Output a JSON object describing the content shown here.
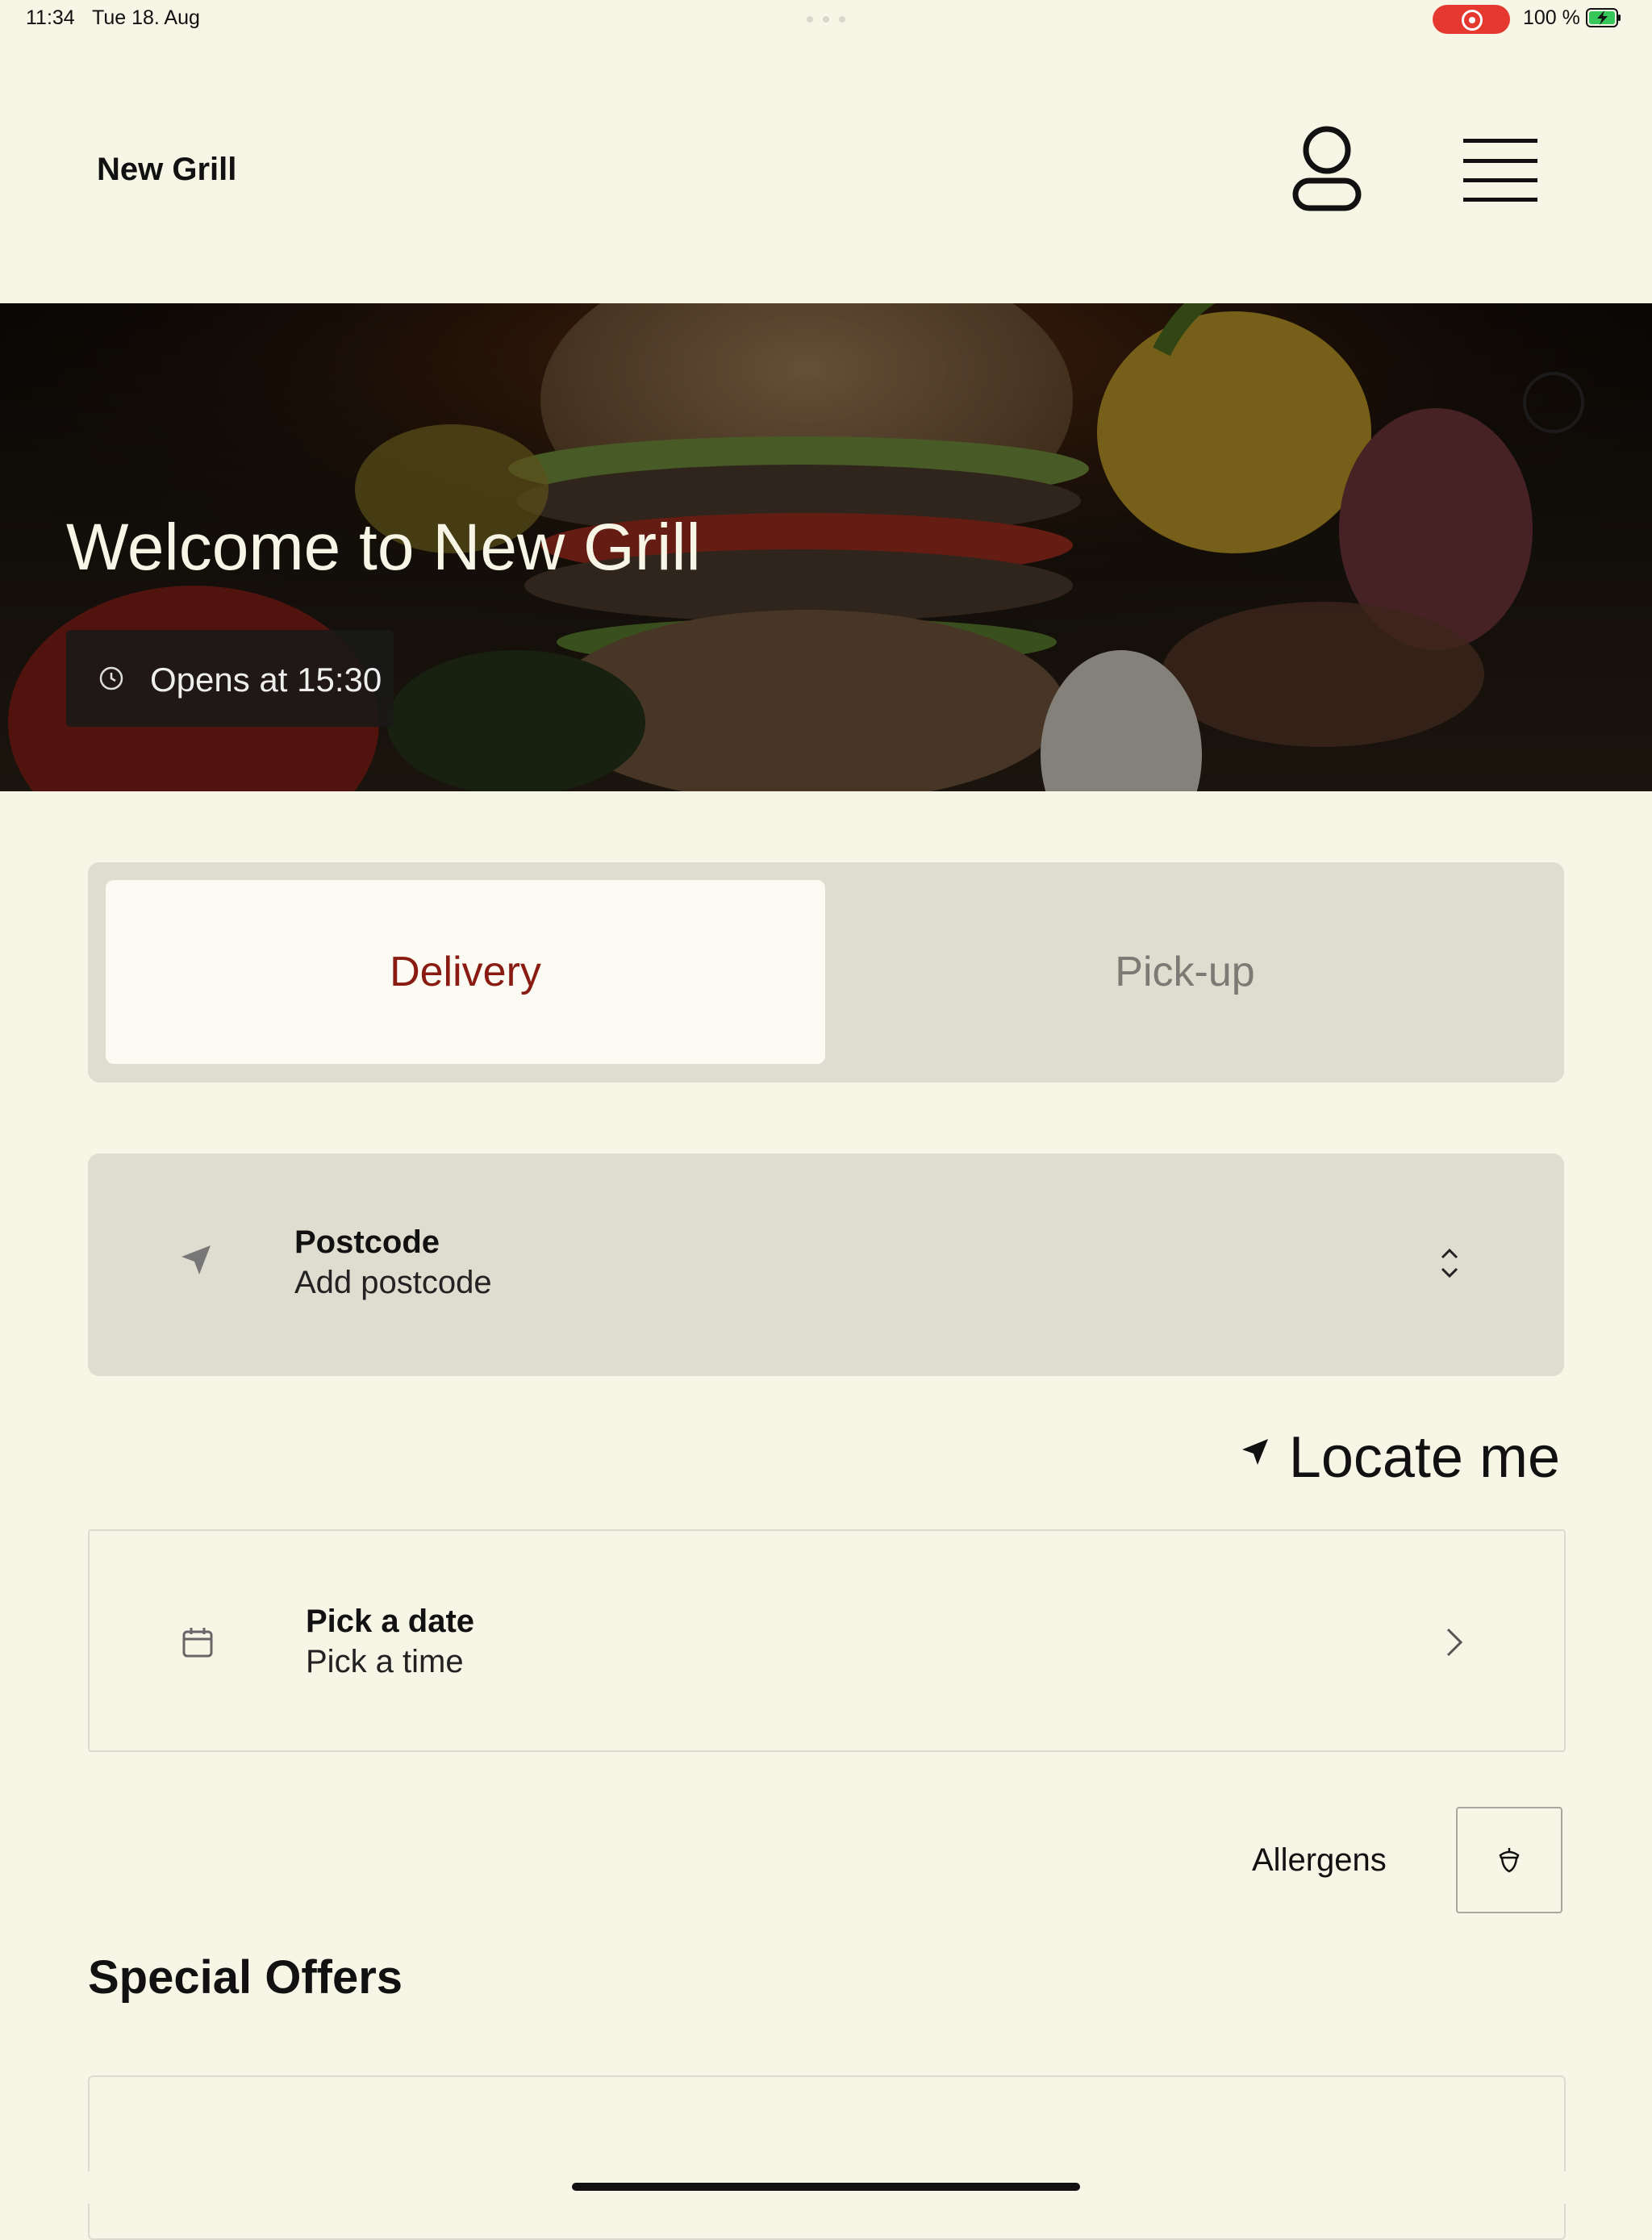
{
  "status_bar": {
    "time": "11:34",
    "date": "Tue 18. Aug",
    "battery": "100 %",
    "recording_color": "#e53930",
    "battery_color": "#35c759"
  },
  "header": {
    "title": "New Grill",
    "profile_icon": "person-icon",
    "menu_icon": "hamburger-menu-icon"
  },
  "hero": {
    "title": "Welcome to New Grill",
    "opening": "Opens at 15:30",
    "clock_icon": "clock-icon"
  },
  "order_type": {
    "options": [
      {
        "label": "Delivery",
        "selected": true
      },
      {
        "label": "Pick-up",
        "selected": false
      }
    ],
    "accent": "#8a1b12"
  },
  "postcode": {
    "label": "Postcode",
    "value": "Add postcode",
    "icon": "location-arrow-icon"
  },
  "locate": {
    "label": "Locate me",
    "icon": "location-arrow-icon"
  },
  "schedule": {
    "date_label": "Pick a date",
    "time_label": "Pick a time",
    "icon": "calendar-icon"
  },
  "allergens": {
    "label": "Allergens",
    "icon": "acorn-icon"
  },
  "offers": {
    "title": "Special Offers"
  },
  "colors": {
    "background": "#f6f5e6",
    "panel": "#dfddd0"
  }
}
